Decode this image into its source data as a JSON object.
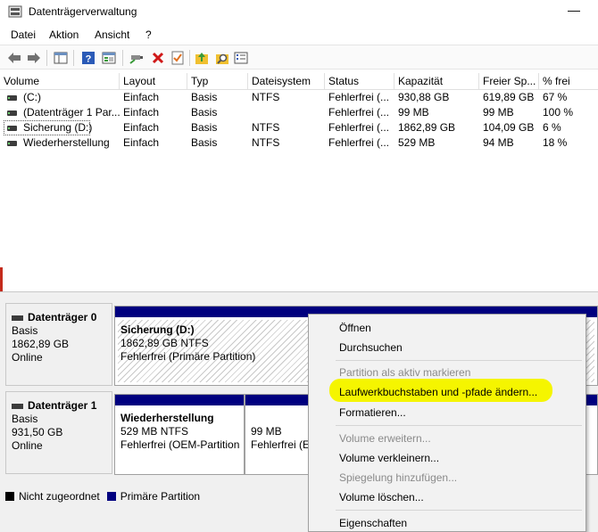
{
  "window": {
    "title": "Datenträgerverwaltung",
    "minimize_glyph": "—"
  },
  "menu": [
    "Datei",
    "Aktion",
    "Ansicht",
    "?"
  ],
  "toolbar": {
    "icons": [
      "back-icon",
      "forward-icon",
      "show-hide-console-tree-icon",
      "help-icon",
      "properties-icon",
      "connect-icon",
      "delete-icon",
      "check-icon",
      "up-icon",
      "search-icon",
      "list-icon"
    ],
    "colors": {
      "delete": "#d01818",
      "help": "#2a5ab7",
      "folder": "#f0c030"
    }
  },
  "volume_list": {
    "columns": [
      "Volume",
      "Layout",
      "Typ",
      "Dateisystem",
      "Status",
      "Kapazität",
      "Freier Sp...",
      "% frei"
    ],
    "rows": [
      [
        "(C:)",
        "Einfach",
        "Basis",
        "NTFS",
        "Fehlerfrei (...",
        "930,88 GB",
        "619,89 GB",
        "67 %"
      ],
      [
        "(Datenträger 1 Par...",
        "Einfach",
        "Basis",
        "",
        "Fehlerfrei (...",
        "99 MB",
        "99 MB",
        "100 %"
      ],
      [
        "Sicherung (D:)",
        "Einfach",
        "Basis",
        "NTFS",
        "Fehlerfrei (...",
        "1862,89 GB",
        "104,09 GB",
        "6 %"
      ],
      [
        "Wiederherstellung",
        "Einfach",
        "Basis",
        "NTFS",
        "Fehlerfrei (...",
        "529 MB",
        "94 MB",
        "18 %"
      ]
    ],
    "selected_row": 2
  },
  "disks": [
    {
      "name": "Datenträger 0",
      "type": "Basis",
      "size": "1862,89 GB",
      "state": "Online",
      "partitions": [
        {
          "title": "Sicherung  (D:)",
          "size": "1862,89 GB NTFS",
          "status": "Fehlerfrei (Primäre Partition)"
        }
      ]
    },
    {
      "name": "Datenträger 1",
      "type": "Basis",
      "size": "931,50 GB",
      "state": "Online",
      "partitions": [
        {
          "title": "Wiederherstellung",
          "size": "529 MB NTFS",
          "status": "Fehlerfrei (OEM-Partition"
        },
        {
          "title": "",
          "size": "99 MB",
          "status": "Fehlerfrei (E"
        }
      ]
    }
  ],
  "legend": [
    {
      "label": "Nicht zugeordnet",
      "color": "#000000"
    },
    {
      "label": "Primäre Partition",
      "color": "#00007f"
    }
  ],
  "context_menu": {
    "items": [
      {
        "label": "Öffnen",
        "enabled": true
      },
      {
        "label": "Durchsuchen",
        "enabled": true
      },
      {
        "label": "Partition als aktiv markieren",
        "enabled": false
      },
      {
        "label": "Laufwerkbuchstaben und -pfade ändern...",
        "enabled": true,
        "highlighted": true
      },
      {
        "label": "Formatieren...",
        "enabled": true
      },
      {
        "label": "Volume erweitern...",
        "enabled": false
      },
      {
        "label": "Volume verkleinern...",
        "enabled": true
      },
      {
        "label": "Spiegelung hinzufügen...",
        "enabled": false
      },
      {
        "label": "Volume löschen...",
        "enabled": true
      },
      {
        "label": "Eigenschaften",
        "enabled": true
      }
    ],
    "highlight_color": "#f5f500"
  }
}
